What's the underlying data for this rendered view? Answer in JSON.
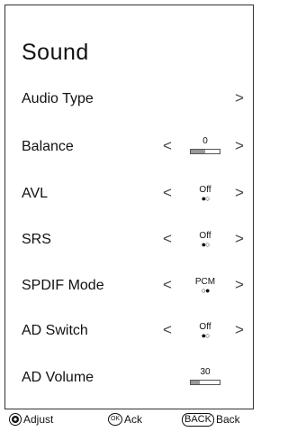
{
  "title": "Sound",
  "items": {
    "audio_type": {
      "label": "Audio Type",
      "right_arrow": ">"
    },
    "balance": {
      "label": "Balance",
      "left_arrow": "<",
      "right_arrow": ">",
      "value": "0",
      "level_percent": 50
    },
    "avl": {
      "label": "AVL",
      "left_arrow": "<",
      "right_arrow": ">",
      "value": "Off",
      "dots": "●○"
    },
    "srs": {
      "label": "SRS",
      "left_arrow": "<",
      "right_arrow": ">",
      "value": "Off",
      "dots": "●○"
    },
    "spdif": {
      "label": "SPDIF Mode",
      "left_arrow": "<",
      "right_arrow": ">",
      "value": "PCM",
      "dots": "○●"
    },
    "ad_switch": {
      "label": "AD Switch",
      "left_arrow": "<",
      "right_arrow": ">",
      "value": "Off",
      "dots": "●○"
    },
    "ad_volume": {
      "label": "AD Volume",
      "value": "30",
      "level_percent": 30
    }
  },
  "footer": {
    "adjust": "Adjust",
    "ok_icon": "OK",
    "ack": "Ack",
    "back_icon": "BACK",
    "back": "Back"
  },
  "icons": {
    "dpad": "dpad-icon",
    "ok": "ok-button-icon",
    "back": "back-button-icon"
  }
}
